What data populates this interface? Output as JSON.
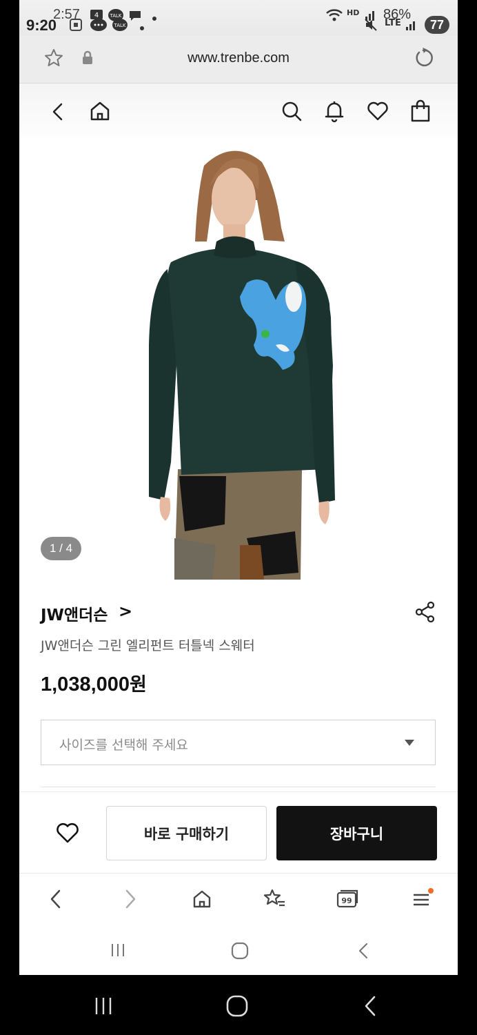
{
  "status_bar": {
    "time": "9:20",
    "time_overlay": "2:57",
    "battery": "86%",
    "notification_count": "77",
    "network": "HD",
    "lte": "LTE"
  },
  "url_bar": {
    "url": "www.trenbe.com"
  },
  "product": {
    "image_counter": "1 / 4",
    "brand": "JW앤더슨",
    "brand_chevron": ">",
    "name": "JW앤더슨 그린 엘리펀트 터틀넥 스웨터",
    "price": "1,038,000",
    "price_unit": "원",
    "size_placeholder": "사이즈를 선택해 주세요"
  },
  "actions": {
    "buy_now": "바로 구매하기",
    "add_to_cart": "장바구니"
  },
  "browser_nav": {
    "tabs_count": "99"
  },
  "colors": {
    "cart_button": "#121212",
    "sweater": "#1f3a34",
    "elephant": "#4aa3e0",
    "notification_dot": "#f26d21"
  }
}
